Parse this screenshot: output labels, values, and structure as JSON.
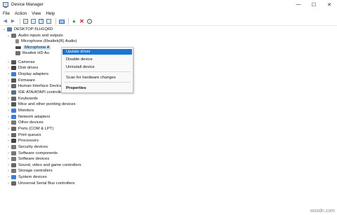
{
  "window": {
    "title": "Device Manager",
    "minimize": "—",
    "maximize": "☐",
    "close": "✕"
  },
  "menu": [
    "File",
    "Action",
    "View",
    "Help"
  ],
  "tree": {
    "root": "DESKTOP-5LH1Q6D",
    "category_audio": "Audio inputs and outputs",
    "audio_children": [
      "Microphone (Realtek(R) Audio)",
      "Microphone A",
      "Realtek HD Au"
    ],
    "categories": [
      {
        "label": "Cameras",
        "color": "#555555"
      },
      {
        "label": "Disk drives",
        "color": "#444444"
      },
      {
        "label": "Display adapters",
        "color": "#3b7dd8"
      },
      {
        "label": "Firmware",
        "color": "#555555"
      },
      {
        "label": "Human Interface Devices",
        "color": "#666666"
      },
      {
        "label": "IDE ATA/ATAPI controllers",
        "color": "#5a6f86"
      },
      {
        "label": "Keyboards",
        "color": "#666666"
      },
      {
        "label": "Mice and other pointing devices",
        "color": "#555555"
      },
      {
        "label": "Monitors",
        "color": "#3b7dd8"
      },
      {
        "label": "Network adapters",
        "color": "#3b7dd8"
      },
      {
        "label": "Other devices",
        "color": "#777777"
      },
      {
        "label": "Ports (COM & LPT)",
        "color": "#666666"
      },
      {
        "label": "Print queues",
        "color": "#666666"
      },
      {
        "label": "Processors",
        "color": "#444444"
      },
      {
        "label": "Security devices",
        "color": "#777777"
      },
      {
        "label": "Software components",
        "color": "#777777"
      },
      {
        "label": "Software devices",
        "color": "#777777"
      },
      {
        "label": "Sound, video and game controllers",
        "color": "#666666"
      },
      {
        "label": "Storage controllers",
        "color": "#777777"
      },
      {
        "label": "System devices",
        "color": "#3b7dd8"
      },
      {
        "label": "Universal Serial Bus controllers",
        "color": "#666666"
      }
    ]
  },
  "context_menu": {
    "update": "Update driver",
    "disable": "Disable device",
    "uninstall": "Uninstall device",
    "scan": "Scan for hardware changes",
    "properties": "Properties"
  },
  "watermark": "wsxdn.com",
  "colors": {
    "accent": "#1976d2",
    "selection": "#cce4f7"
  }
}
